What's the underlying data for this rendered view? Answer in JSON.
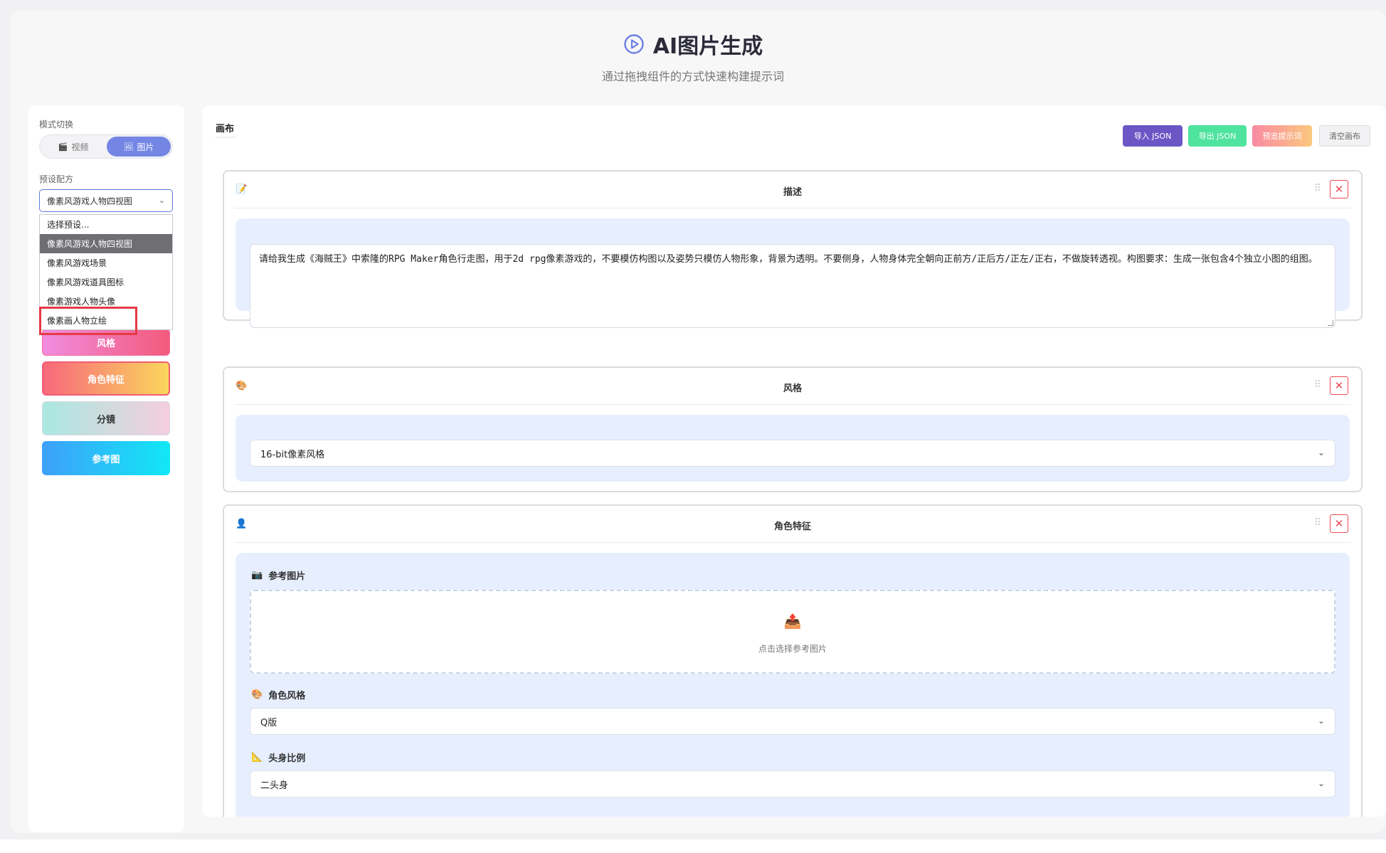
{
  "header": {
    "title": "AI图片生成",
    "subtitle": "通过拖拽组件的方式快速构建提示词"
  },
  "sidebar": {
    "mode_label": "模式切换",
    "mode_video": "视频",
    "mode_image": "图片",
    "mode_selected": "图片",
    "preset_label": "预设配方",
    "preset_selected": "像素风游戏人物四视图",
    "preset_options": [
      "选择预设...",
      "像素风游戏人物四视图",
      "像素风游戏场景",
      "像素风游戏道具图标",
      "像素游戏人物头像",
      "像素画人物立绘"
    ],
    "components": {
      "style": "风格",
      "character": "角色特征",
      "storyboard": "分镜",
      "reference": "参考图"
    }
  },
  "canvas": {
    "title": "画布",
    "toolbar": {
      "import": "导入 JSON",
      "export": "导出 JSON",
      "preview": "预览提示词",
      "clear": "清空画布"
    },
    "blocks": {
      "description": {
        "title": "描述",
        "text": "请给我生成《海贼王》中索隆的RPG Maker角色行走图，用于2d rpg像素游戏的，不要模仿构图以及姿势只模仿人物形象，背景为透明。不要侧身，人物身体完全朝向正前方/正后方/正左/正右，不做旋转透视。构图要求：生成一张包含4个独立小图的组图。"
      },
      "style": {
        "title": "风格",
        "value": "16-bit像素风格"
      },
      "character": {
        "title": "角色特征",
        "reference_label": "参考图片",
        "upload_hint": "点击选择参考图片",
        "char_style_label": "角色风格",
        "char_style_value": "Q版",
        "head_ratio_label": "头身比例",
        "head_ratio_value": "二头身"
      }
    }
  },
  "colors": {
    "accent": "#7486e4",
    "close": "#e94a53",
    "highlight": "#e43b45"
  }
}
